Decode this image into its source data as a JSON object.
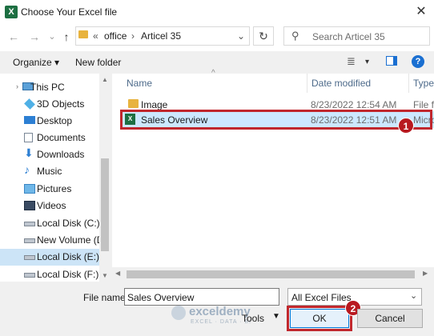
{
  "window": {
    "title": "Choose Your Excel file",
    "app_icon_letter": "X",
    "close_glyph": "✕"
  },
  "nav": {
    "back": "←",
    "forward": "→",
    "dropdown": "⌄",
    "up": "↑",
    "refresh": "↻"
  },
  "address": {
    "overflow": "«",
    "crumbs": [
      "office",
      "Articel 35"
    ],
    "separator": "›",
    "dropdown": "⌄"
  },
  "search": {
    "placeholder": "Search Articel 35",
    "icon": "⚲"
  },
  "toolbar": {
    "organize": "Organize ▾",
    "new_folder": "New folder",
    "view_icon": "≣",
    "view_dropdown": "▾",
    "help": "?"
  },
  "sidebar": {
    "items": [
      {
        "label": "This PC",
        "icon": "pc-icon"
      },
      {
        "label": "3D Objects",
        "icon": "cube-icon"
      },
      {
        "label": "Desktop",
        "icon": "desktop-icon"
      },
      {
        "label": "Documents",
        "icon": "documents-icon"
      },
      {
        "label": "Downloads",
        "icon": "downloads-icon"
      },
      {
        "label": "Music",
        "icon": "music-icon"
      },
      {
        "label": "Pictures",
        "icon": "pictures-icon"
      },
      {
        "label": "Videos",
        "icon": "videos-icon"
      },
      {
        "label": "Local Disk (C:)",
        "icon": "disk-icon"
      },
      {
        "label": "New Volume (D:",
        "icon": "disk-icon"
      },
      {
        "label": "Local Disk (E:)",
        "icon": "disk-icon",
        "selected": true
      },
      {
        "label": "Local Disk (F:)",
        "icon": "disk-icon"
      }
    ]
  },
  "files": {
    "columns": {
      "name": "Name",
      "date": "Date modified",
      "type": "Type",
      "sort_glyph": "^"
    },
    "rows": [
      {
        "name": "Image",
        "date": "8/23/2022 12:54 AM",
        "type": "File fo",
        "icon": "folder-icon"
      },
      {
        "name": "Sales Overview",
        "date": "8/23/2022 12:51 AM",
        "type": "Micro",
        "icon": "excel-file-icon",
        "selected": true
      }
    ]
  },
  "bottom": {
    "file_name_label": "File name:",
    "file_name_value": "Sales Overview",
    "file_type": "All Excel Files",
    "tools": "Tools",
    "ok": "OK",
    "cancel": "Cancel",
    "watermark": "exceldemy",
    "watermark_sub": "EXCEL · DATA · BI"
  },
  "markers": {
    "one": "1",
    "two": "2"
  },
  "colors": {
    "accent_red": "#c0272d",
    "selection": "#cce8ff",
    "excel_green": "#1d6f42"
  }
}
